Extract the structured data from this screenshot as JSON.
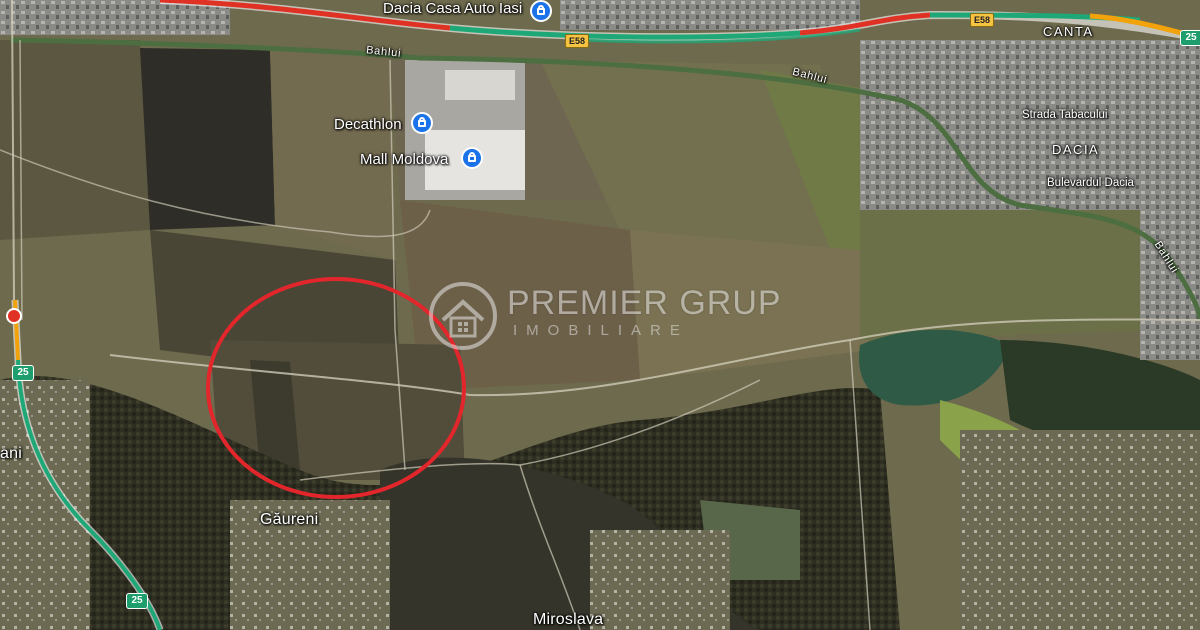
{
  "map": {
    "pois": [
      {
        "id": "dacia-casa-auto",
        "label": "Dacia Casa Auto Iasi",
        "icon": "shopping-bag-icon"
      },
      {
        "id": "decathlon",
        "label": "Decathlon",
        "icon": "shopping-bag-icon"
      },
      {
        "id": "mall-moldova",
        "label": "Mall Moldova",
        "icon": "shopping-bag-icon"
      }
    ],
    "places": {
      "gaureni": "Găureni",
      "miroslava": "Miroslava",
      "ani_partial": "ani",
      "canta": "CANTA",
      "dacia": "DACIA"
    },
    "streets": {
      "tabacului": "Strada Tabacului",
      "bulevardul_dacia": "Bulevardul Dacia"
    },
    "rivers": {
      "bahlui_west": "Bahlui",
      "bahlui_mid": "Bahlui",
      "bahlui_east": "Bahlui"
    },
    "road_shields": {
      "e58_a": "E58",
      "e58_b": "E58",
      "dn25_north": "25",
      "dn25_south": "25",
      "dn25_top": "25"
    },
    "watermark": {
      "name": "PREMIER GRUP",
      "subtitle": "IMOBILIARE"
    },
    "highlight": {
      "color": "#e3262b",
      "shape": "ellipse"
    },
    "traffic_colors": {
      "free": "#1fa877",
      "slow": "#f2a20a",
      "heavy": "#e03224"
    }
  }
}
